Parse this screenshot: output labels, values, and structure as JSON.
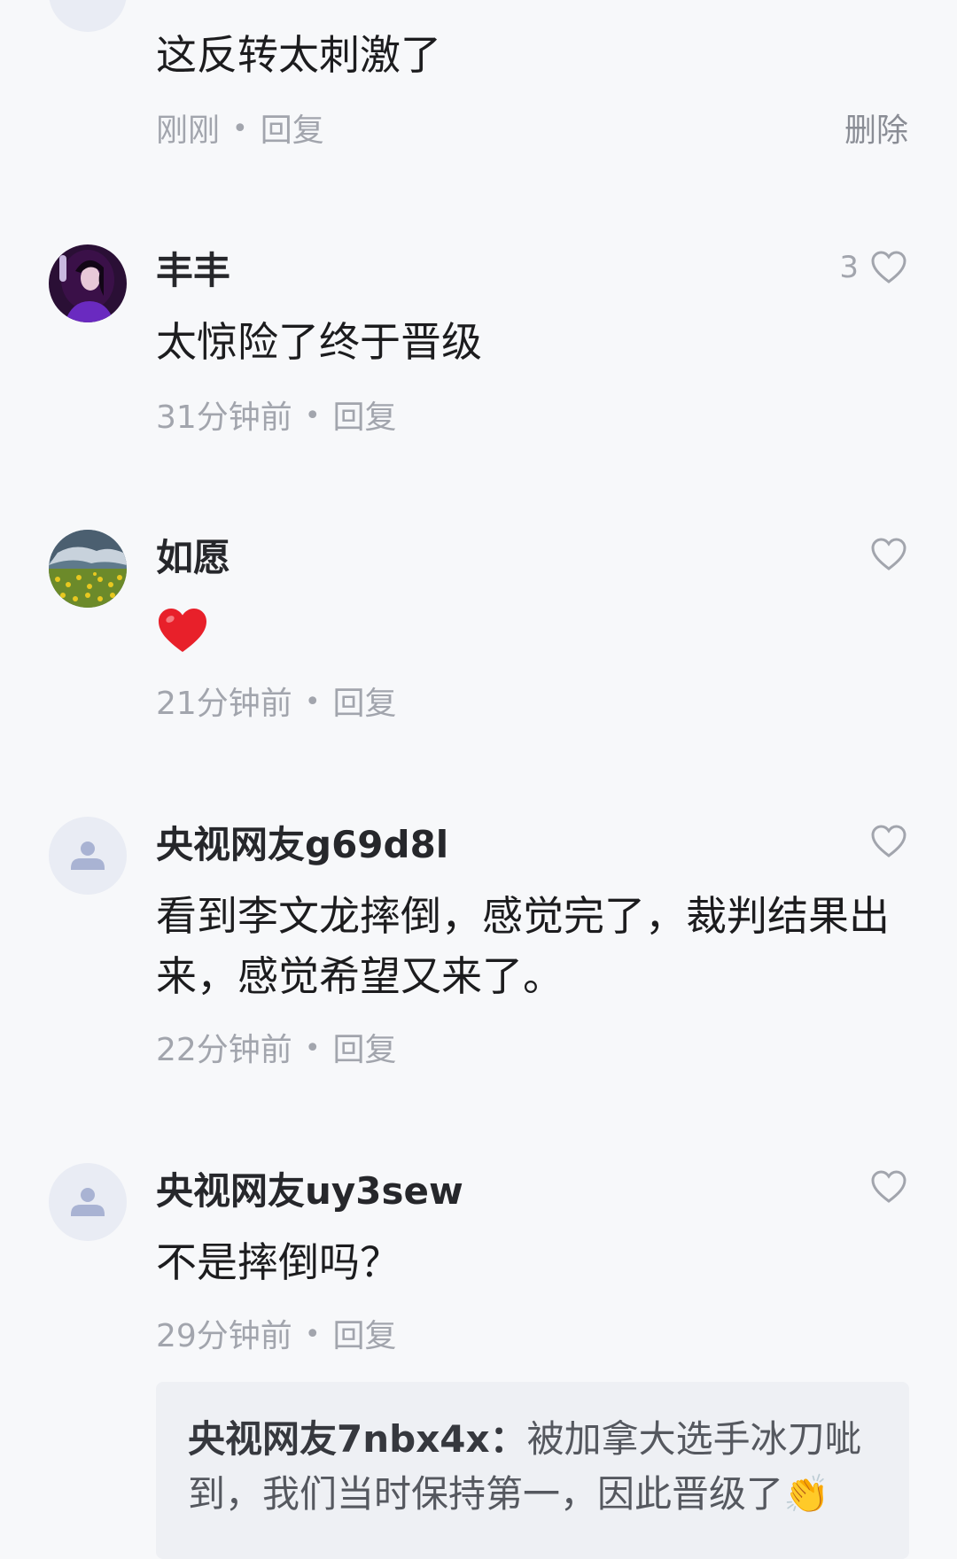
{
  "comments": [
    {
      "text": "这反转太刺激了",
      "time": "刚刚",
      "reply": "回复",
      "action": "删除"
    },
    {
      "username": "丰丰",
      "text": "太惊险了终于晋级",
      "time": "31分钟前",
      "reply": "回复",
      "likes": "3"
    },
    {
      "username": "如愿",
      "emoji": "❤️",
      "time": "21分钟前",
      "reply": "回复"
    },
    {
      "username": "央视网友g69d8l",
      "text": "看到李文龙摔倒，感觉完了，裁判结果出来，感觉希望又来了。",
      "time": "22分钟前",
      "reply": "回复"
    },
    {
      "username": "央视网友uy3sew",
      "text": "不是摔倒吗？",
      "time": "29分钟前",
      "reply": "回复",
      "sub_reply": {
        "username": "央视网友7nbx4x：",
        "text": "被加拿大选手冰刀呲到，我们当时保持第一，因此晋级了👏"
      }
    }
  ],
  "icons": {
    "like": "heart-outline-icon",
    "default_avatar": "user-silhouette-icon"
  },
  "colors": {
    "background": "#f7f8fa",
    "secondary_text": "#a2a5ad",
    "heart_red": "#e8202a"
  }
}
